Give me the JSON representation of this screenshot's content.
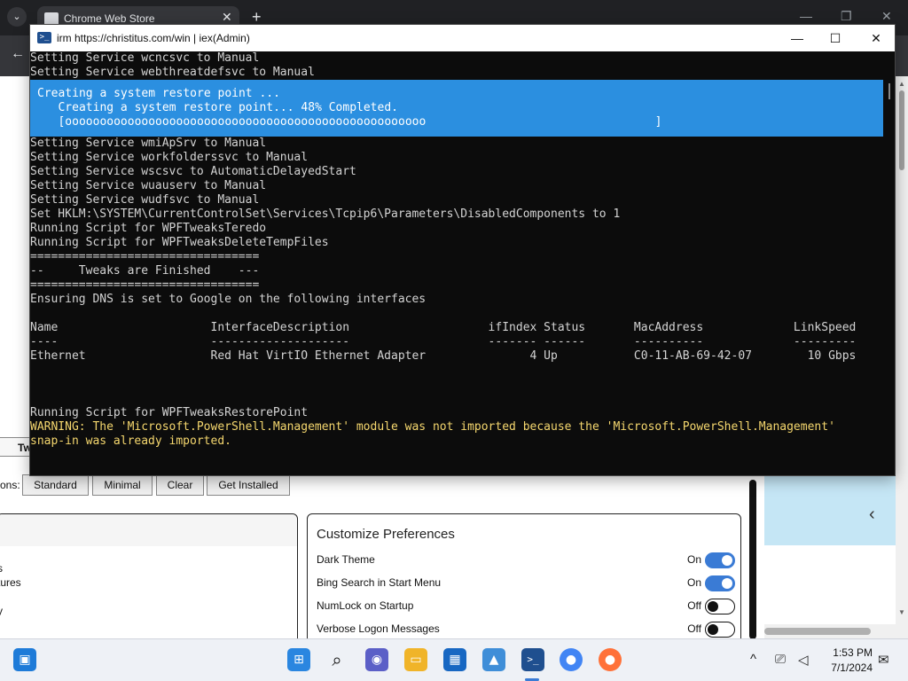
{
  "browser": {
    "tab_title": "Chrome Web Store",
    "tab_close": "✕",
    "new_tab": "+",
    "tab_list": "⌄",
    "back": "←",
    "win_min": "—",
    "win_max": "❐",
    "win_close": "✕"
  },
  "terminal": {
    "title": "irm https://christitus.com/win | iex(Admin)",
    "controls": {
      "minimize": "—",
      "maximize": "☐",
      "close": "✕"
    },
    "lines_before": [
      "Setting Service wcncsvc to Manual",
      "Setting Service webthreatdefsvc to Manual"
    ],
    "progress": {
      "activity": "Creating a system restore point ...",
      "status": "   Creating a system restore point... 48% Completed.",
      "bar": "   [oooooooooooooooooooooooooooooooooooooooooooooooooooo                                 ]",
      "percent_complete": 48
    },
    "lines_after": [
      "Setting Service wmiApSrv to Manual",
      "Setting Service workfolderssvc to Manual",
      "Setting Service wscsvc to AutomaticDelayedStart",
      "Setting Service wuauserv to Manual",
      "Setting Service wudfsvc to Manual",
      "Set HKLM:\\SYSTEM\\CurrentControlSet\\Services\\Tcpip6\\Parameters\\DisabledComponents to 1",
      "Running Script for WPFTweaksTeredo",
      "Running Script for WPFTweaksDeleteTempFiles",
      "=================================",
      "--     Tweaks are Finished    ---",
      "=================================",
      "Ensuring DNS is set to Google on the following interfaces",
      "",
      "Name                      InterfaceDescription                    ifIndex Status       MacAddress             LinkSpeed",
      "----                      --------------------                    ------- ------       ----------             ---------",
      "Ethernet                  Red Hat VirtIO Ethernet Adapter               4 Up           C0-11-AB-69-42-07        10 Gbps",
      "",
      "",
      "",
      "Running Script for WPFTweaksRestorePoint"
    ],
    "warning_lines": [
      "WARNING: The 'Microsoft.PowerShell.Management' module was not imported because the 'Microsoft.PowerShell.Management'",
      "snap-in was already imported."
    ]
  },
  "winutil": {
    "tab_stub_label": "Tw",
    "presets_label": "ons:",
    "preset_buttons": [
      "Standard",
      "Minimal",
      "Clear",
      "Get Installed"
    ],
    "left_items": [
      "s",
      "tures",
      "y"
    ],
    "customize": {
      "title": "Customize Preferences",
      "prefs": [
        {
          "label": "Dark Theme",
          "state": "On"
        },
        {
          "label": "Bing Search in Start Menu",
          "state": "On"
        },
        {
          "label": "NumLock on Startup",
          "state": "Off"
        },
        {
          "label": "Verbose Logon Messages",
          "state": "Off"
        }
      ]
    }
  },
  "right_pane": {
    "chevron": "‹"
  },
  "taskbar": {
    "time": "1:53 PM",
    "date": "7/1/2024",
    "tray_chevron": "^"
  },
  "colors": {
    "progress_bg": "#2b8fe0",
    "warning": "#f5d76e",
    "toggle_on": "#3a7bd5"
  }
}
